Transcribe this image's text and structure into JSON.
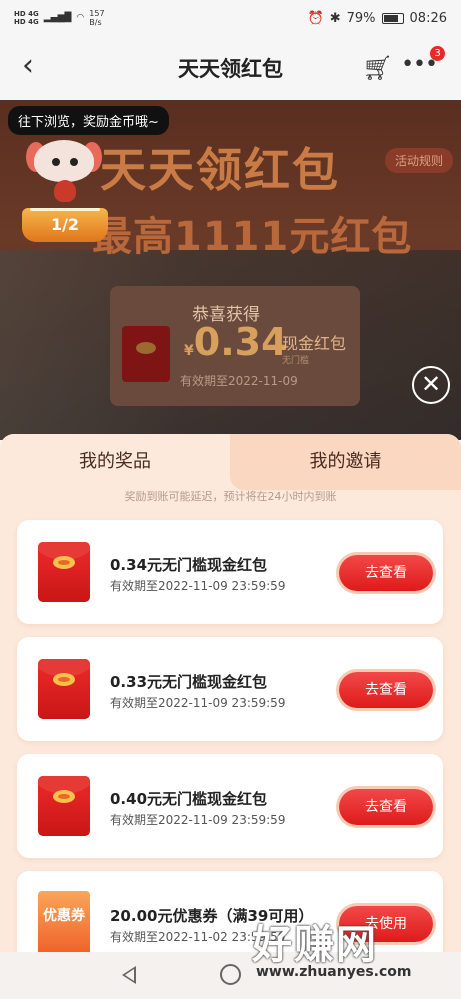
{
  "status_bar": {
    "network_top": "HD 4G",
    "network_bottom": "HD 4G",
    "speed_value": "157",
    "speed_unit": "B/s",
    "battery": "79%",
    "time": "08:26"
  },
  "nav": {
    "title": "天天领红包",
    "badge_count": "3"
  },
  "hero": {
    "title": "天天领红包",
    "subtitle": "最高1111元红包",
    "rules_label": "活动规则",
    "congrats": "恭喜获得",
    "currency": "¥",
    "amount": "0.34",
    "kind": "现金红包",
    "kind_sub": "无门槛",
    "valid": "有效期至2022-11-09"
  },
  "tooltip": "往下浏览，奖励金币哦~",
  "browse_progress": "1/2",
  "tabs": [
    {
      "label": "我的奖品",
      "active": true
    },
    {
      "label": "我的邀请",
      "active": false
    }
  ],
  "notice": "奖励到账可能延迟，预计将在24小时内到账",
  "prizes": [
    {
      "title": "0.34元无门槛现金红包",
      "valid": "有效期至2022-11-09 23:59:59",
      "action": "去查看",
      "icon": "red-envelope-icon"
    },
    {
      "title": "0.33元无门槛现金红包",
      "valid": "有效期至2022-11-09 23:59:59",
      "action": "去查看",
      "icon": "red-envelope-icon"
    },
    {
      "title": "0.40元无门槛现金红包",
      "valid": "有效期至2022-11-09 23:59:59",
      "action": "去查看",
      "icon": "red-envelope-icon"
    },
    {
      "title": "20.00元优惠券（满39可用）",
      "valid": "有效期至2022-11-02 23:59:59",
      "action": "去使用",
      "icon": "coupon-icon",
      "icon_label": "优惠券"
    }
  ],
  "watermark": {
    "text": "好赚网",
    "url": "www.zhuanyes.com"
  },
  "colors": {
    "accent_red": "#e42b2b",
    "sheet_bg": "#fde9dc",
    "tab_inactive_bg": "#f9d7c1"
  }
}
